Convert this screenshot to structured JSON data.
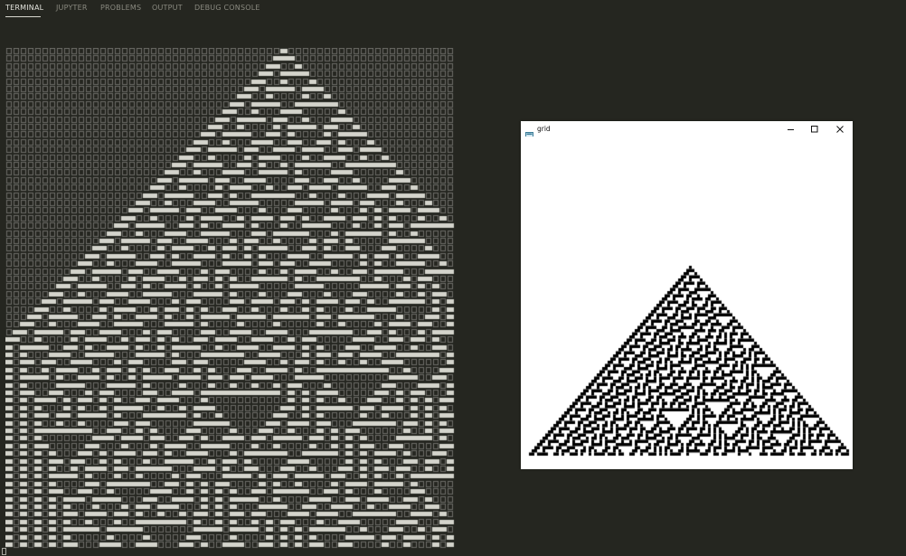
{
  "panel": {
    "tabs": [
      {
        "label": "TERMINAL",
        "active": true
      },
      {
        "label": "JUPYTER",
        "active": false
      },
      {
        "label": "PROBLEMS",
        "active": false
      },
      {
        "label": "OUTPUT",
        "active": false
      },
      {
        "label": "DEBUG CONSOLE",
        "active": false
      }
    ]
  },
  "terminal": {
    "content": "Elementary cellular automaton (rule 30) printed as block characters",
    "rows": 66,
    "cols": 62
  },
  "grid_window": {
    "title": "grid",
    "icon": "app-window-icon",
    "controls": [
      "minimize-icon",
      "maximize-icon",
      "close-icon"
    ],
    "rule": 30,
    "rows": 60,
    "cols": 121
  },
  "colors": {
    "background": "#252620",
    "text": "#d8d8d0",
    "muted": "#8a8a80",
    "cell_on": "#d4d4cc",
    "cell_off": "#6e6e68",
    "grid_on": "#000000",
    "grid_off": "#ffffff"
  }
}
